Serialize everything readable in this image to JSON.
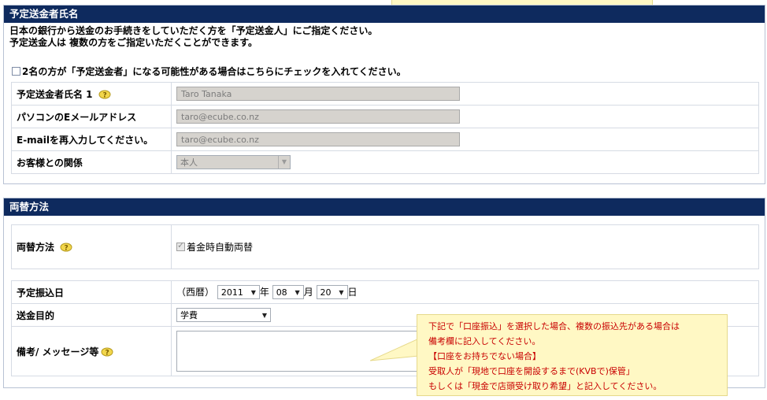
{
  "sender_section": {
    "title": "予定送金者氏名",
    "intro_line1": "日本の銀行から送金のお手続きをしていただく方を「予定送金人」にご指定ください。",
    "intro_line2": "予定送金人は 複数の方をご指定いただくことができます。",
    "two_senders_checkbox_label": "2名の方が「予定送金者」になる可能性がある場合はこちらにチェックを入れてください。",
    "name_label": "予定送金者氏名 1",
    "name_value": "Taro Tanaka",
    "email_label": "パソコンのEメールアドレス",
    "email_value": "taro@ecube.co.nz",
    "email_confirm_label": "E-mailを再入力してください。",
    "email_confirm_value": "taro@ecube.co.nz",
    "relation_label": "お客様との関係",
    "relation_value": "本人"
  },
  "exchange_section": {
    "title": "両替方法",
    "method_label": "両替方法",
    "auto_exchange_label": "着金時自動両替",
    "date_label": "予定振込日",
    "era_label": "（西暦）",
    "year_value": "2011",
    "year_unit": "年",
    "month_value": "08",
    "month_unit": "月",
    "day_value": "20",
    "day_unit": "日",
    "purpose_label": "送金目的",
    "purpose_value": "学費",
    "remarks_label": "備考/ メッセージ等"
  },
  "tooltip": {
    "line1": "下記で「口座振込」を選択した場合、複数の振込先がある場合は",
    "line2": "備考欄に記入してください。",
    "line3": "【口座をお持ちでない場合】",
    "line4": "受取人が「現地で口座を開設するまで(KVBで)保管」",
    "line5": "もしくは「現金で店頭受け取り希望」と記入してください。"
  },
  "colors": {
    "header_bg": "#0e2a5e",
    "tooltip_bg": "#fff8c4",
    "tooltip_text": "#c80000"
  }
}
